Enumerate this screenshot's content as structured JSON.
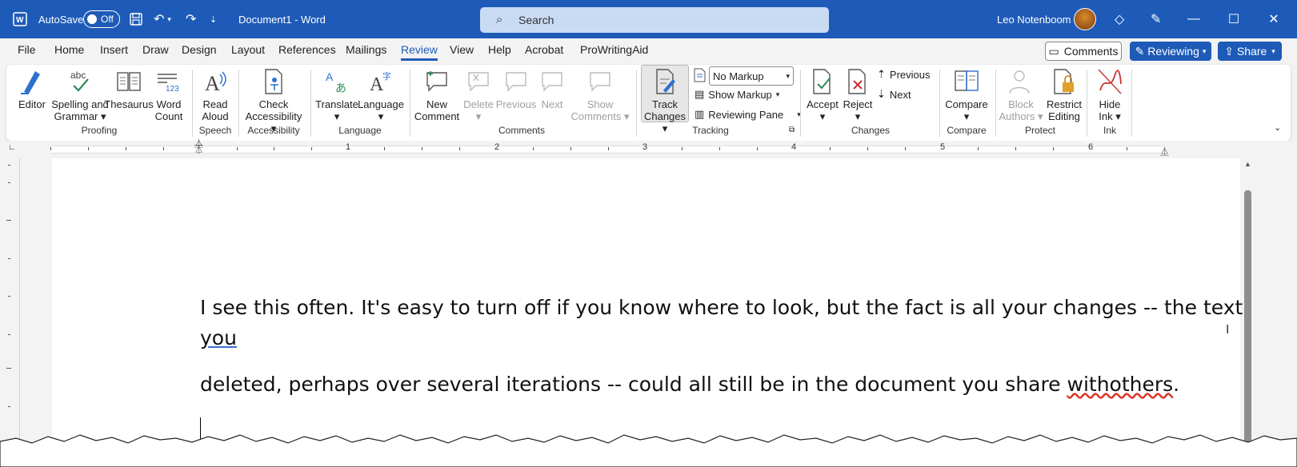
{
  "titlebar": {
    "autosave_label": "AutoSave",
    "autosave_state": "Off",
    "doc_title": "Document1 - Word",
    "search_placeholder": "Search",
    "user_name": "Leo Notenboom",
    "bg_color": "#1e5bb8"
  },
  "tabs": [
    "File",
    "Home",
    "Insert",
    "Draw",
    "Design",
    "Layout",
    "References",
    "Mailings",
    "Review",
    "View",
    "Help",
    "Acrobat",
    "ProWritingAid"
  ],
  "active_tab": "Review",
  "top_right": {
    "comments": "Comments",
    "reviewing": "Reviewing",
    "share": "Share"
  },
  "ribbon": {
    "editor": "Editor",
    "spelling_1": "Spelling and",
    "spelling_2": "Grammar",
    "thesaurus": "Thesaurus",
    "word_1": "Word",
    "word_2": "Count",
    "proofing": "Proofing",
    "read_1": "Read",
    "read_2": "Aloud",
    "speech": "Speech",
    "check_1": "Check",
    "check_2": "Accessibility",
    "accessibility": "Accessibility",
    "translate": "Translate",
    "language_btn": "Language",
    "language": "Language",
    "new_1": "New",
    "new_2": "Comment",
    "delete": "Delete",
    "previous": "Previous",
    "next": "Next",
    "show_1": "Show",
    "show_2": "Comments",
    "comments": "Comments",
    "track_1": "Track",
    "track_2": "Changes",
    "markup_select": "No Markup",
    "show_markup": "Show Markup",
    "reviewing_pane": "Reviewing Pane",
    "tracking": "Tracking",
    "accept": "Accept",
    "reject": "Reject",
    "prev_change": "Previous",
    "next_change": "Next",
    "changes": "Changes",
    "compare_btn": "Compare",
    "compare": "Compare",
    "block_1": "Block",
    "block_2": "Authors",
    "restrict_1": "Restrict",
    "restrict_2": "Editing",
    "protect": "Protect",
    "hide_1": "Hide",
    "hide_2": "Ink",
    "ink": "Ink"
  },
  "ruler": {
    "numbers": [
      "1",
      "2",
      "3",
      "4",
      "5",
      "6"
    ]
  },
  "document": {
    "line1": "I see this often. It's easy to turn off if you know where to look, but the fact is all your changes -- the text",
    "line2": "you",
    "line3_a": "deleted, perhaps over several iterations -- could all still be in the document you share ",
    "line3_b": "withothers",
    "line3_c": "."
  }
}
